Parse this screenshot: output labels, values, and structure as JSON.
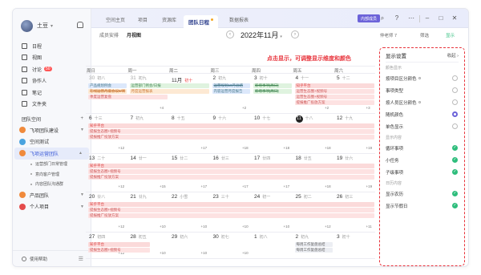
{
  "sidebar": {
    "user": {
      "name": "土豆"
    },
    "nav": [
      {
        "label": "日程",
        "icon": "calendar-icon"
      },
      {
        "label": "视图",
        "icon": "view-icon"
      },
      {
        "label": "讨论",
        "icon": "chat-icon",
        "badge": "50"
      },
      {
        "label": "协作人",
        "icon": "people-icon"
      },
      {
        "label": "笔记",
        "icon": "note-icon"
      },
      {
        "label": "文件夹",
        "icon": "folder-icon"
      }
    ],
    "section_title": "团队空间",
    "teams": [
      {
        "label": "飞项团队建设",
        "color": "#f08a3c"
      },
      {
        "label": "空间测试",
        "color": "#4aa3df"
      },
      {
        "label": "飞项运营团队",
        "color": "#f08a3c",
        "active": true
      }
    ],
    "subs": [
      "运营部门日常管理",
      "意向客户管理",
      "内容团队沟通群"
    ],
    "teams2": [
      {
        "label": "产品团队",
        "color": "#f08a3c"
      },
      {
        "label": "个人项目",
        "color": "#e44b4b"
      }
    ],
    "footer": "使用帮助"
  },
  "topbar": {
    "tabs": [
      "空间主页",
      "项目",
      "资源库",
      "团队日程",
      "数据报表"
    ],
    "active_tab": "团队日程",
    "member_btn": "内部成员"
  },
  "toolbar": {
    "left1": "成员安排",
    "left2": "月视图",
    "month": "2022年11月",
    "right1": "仲老师 7",
    "right2": "筛选",
    "right3": "显示"
  },
  "weekdays": [
    "周日",
    "周一",
    "周二",
    "周三",
    "周四",
    "周五",
    "周六"
  ],
  "weeks": [
    {
      "days": [
        [
          "30",
          "初八"
        ],
        [
          "31",
          "初九"
        ],
        [
          "11月",
          "初十"
        ],
        [
          "2",
          "初九"
        ],
        [
          "3",
          "初十"
        ],
        [
          "4",
          "十一"
        ],
        [
          "5",
          "十二"
        ]
      ],
      "more": [
        "",
        "+4",
        "",
        "+2",
        "",
        "+2",
        "+3"
      ]
    },
    {
      "days": [
        [
          "6",
          "十三"
        ],
        [
          "7",
          "初九"
        ],
        [
          "8",
          "十五"
        ],
        [
          "9",
          "十六"
        ],
        [
          "10",
          "十七"
        ],
        [
          "11",
          "十八"
        ],
        [
          "12",
          "十九"
        ]
      ],
      "more": [
        "+12",
        "",
        "+17",
        "+18",
        "+18",
        "+18",
        "+19"
      ]
    },
    {
      "days": [
        [
          "13",
          "二十"
        ],
        [
          "14",
          "廿一"
        ],
        [
          "15",
          "廿二"
        ],
        [
          "16",
          "廿三"
        ],
        [
          "17",
          "廿四"
        ],
        [
          "18",
          "廿五"
        ],
        [
          "19",
          "廿六"
        ]
      ],
      "more": [
        "+12",
        "+15",
        "+17",
        "+17",
        "+17",
        "+18",
        "+19"
      ]
    },
    {
      "days": [
        [
          "20",
          "廿八"
        ],
        [
          "21",
          "廿九"
        ],
        [
          "22",
          "小雪"
        ],
        [
          "23",
          "三十"
        ],
        [
          "24",
          "初一"
        ],
        [
          "25",
          "初二"
        ],
        [
          "26",
          "初三"
        ]
      ],
      "more": [
        "+12",
        "+10",
        "+10",
        "+10",
        "+10",
        "+12",
        "+11"
      ]
    },
    {
      "days": [
        [
          "27",
          "初四"
        ],
        [
          "28",
          "初五"
        ],
        [
          "29",
          "初六"
        ],
        [
          "30",
          "初七"
        ],
        [
          "1",
          "初八"
        ],
        [
          "2",
          "初九"
        ],
        [
          "3",
          "初十"
        ]
      ],
      "more": [
        "+12",
        "+10",
        "+10",
        "+10",
        "",
        "",
        ""
      ]
    }
  ],
  "events": {
    "w1": [
      "产品规划例会",
      "运营部门例会/日报",
      "月度运营报表",
      "运营规划10月总结",
      "新增事项[周日]",
      "知乎平台",
      "运营生态圈+视频号",
      "在线运营月度会议2/周",
      "季度运营复盘",
      "新增事项[周日]",
      "运营生态圈+视频号",
      "提报推广投放方案",
      "内容运营月度报告"
    ],
    "w2": [
      "知乎平台",
      "提报生态圈+视频号",
      "提报推广投放方案"
    ],
    "w3": [
      "知乎平台",
      "提报生态圈+视频号",
      "提报推广投放方案"
    ],
    "w4": [
      "知乎平台",
      "提报生态圈+视频号",
      "提报推广投放方案"
    ],
    "w5": [
      "知乎平台",
      "提报生态圈+视频号",
      "每周工作复盘总结",
      "每周工作复盘总结"
    ]
  },
  "callout": "点击显示，可调整显示维度和颜色",
  "panel": {
    "title": "显示设置",
    "collapse": "收起",
    "group1": "颜色显示",
    "colors": [
      {
        "label": "按项目区分颜色",
        "on": false
      },
      {
        "label": "事项类型",
        "on": false
      },
      {
        "label": "按人员区分颜色",
        "on": false
      },
      {
        "label": "随机颜色",
        "on": true
      },
      {
        "label": "单色显示",
        "on": false
      }
    ],
    "group2": "显示内容",
    "content": [
      "循环事项",
      "小任务",
      "子级事项"
    ],
    "group3": "日历内容",
    "cal": [
      "显示农历",
      "显示节假日"
    ]
  }
}
